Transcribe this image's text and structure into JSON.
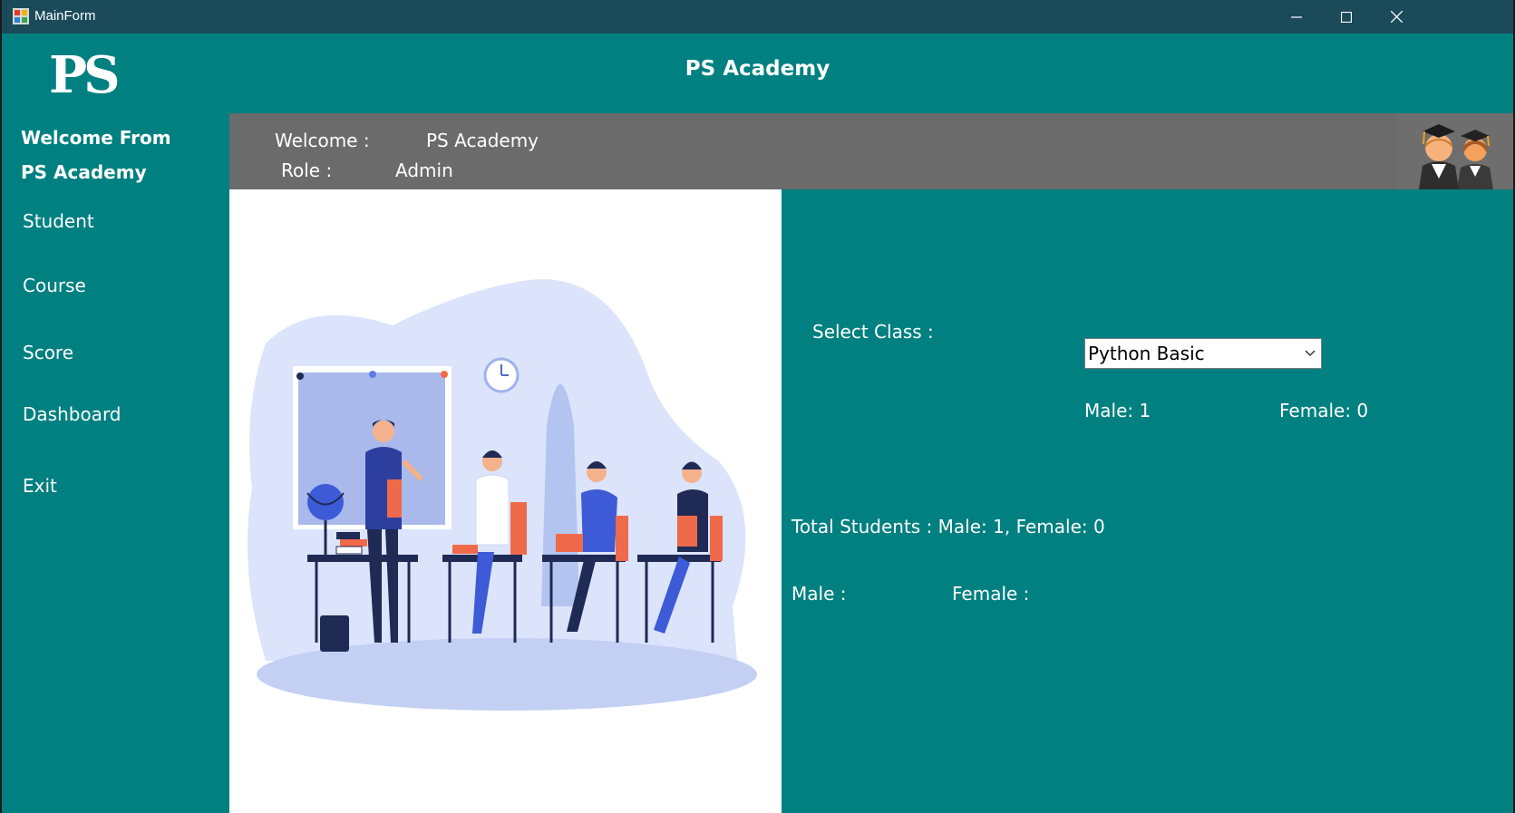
{
  "window": {
    "title": "MainForm"
  },
  "header": {
    "logo": "PS",
    "title": "PS Academy"
  },
  "sidebar": {
    "welcome_line1": "Welcome From",
    "welcome_line2": "PS Academy",
    "items": [
      {
        "label": "Student"
      },
      {
        "label": "Course"
      },
      {
        "label": "Score"
      },
      {
        "label": "Dashboard"
      },
      {
        "label": "Exit"
      }
    ]
  },
  "infobar": {
    "welcome_label": "Welcome :",
    "welcome_value": "PS Academy",
    "role_label": "Role :",
    "role_value": "Admin"
  },
  "dashboard": {
    "select_class_label": "Select Class :",
    "selected_class": "Python Basic",
    "class_male": "Male: 1",
    "class_female": "Female: 0",
    "total_students": "Total Students : Male: 1, Female: 0",
    "male_label": "Male :",
    "female_label": "Female :"
  },
  "colors": {
    "teal": "#008080",
    "titlebar": "#1b4b5a",
    "infobar": "#6b6b6b"
  }
}
